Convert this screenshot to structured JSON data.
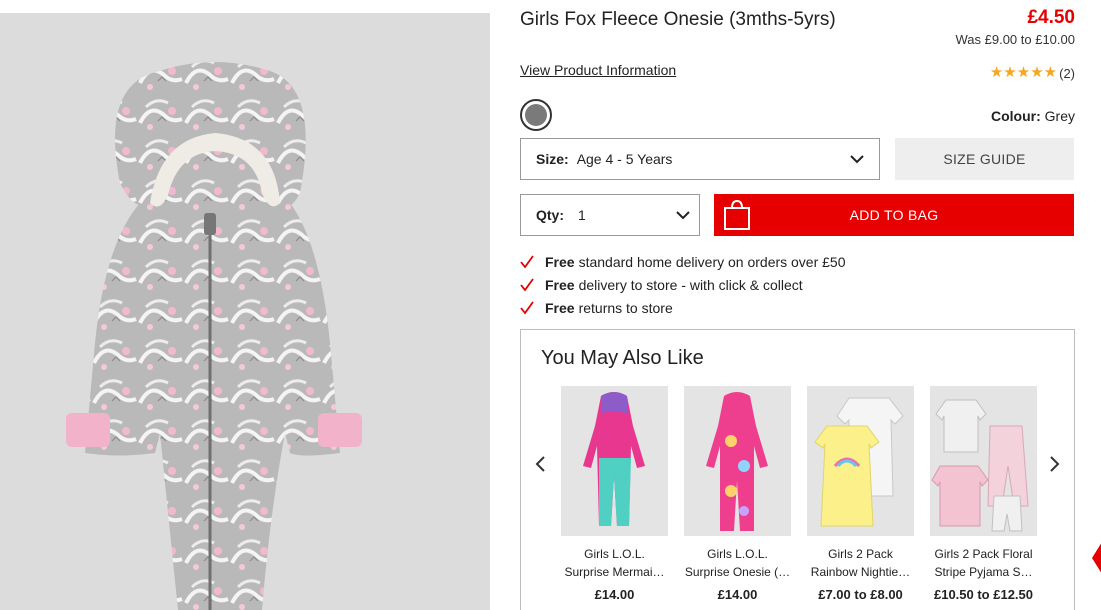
{
  "product": {
    "title": "Girls Fox Fleece Onesie (3mths-5yrs)",
    "price": "£4.50",
    "was_price": "Was £9.00 to £10.00",
    "view_info_label": "View Product Information",
    "rating": {
      "stars": 5,
      "count": "(2)"
    },
    "colour": {
      "label": "Colour:",
      "value": "Grey",
      "swatch": "#7a7a7a"
    }
  },
  "size_select": {
    "label": "Size:",
    "value": "Age 4 - 5 Years"
  },
  "size_guide_label": "SIZE GUIDE",
  "qty_select": {
    "label": "Qty:",
    "value": "1"
  },
  "add_to_bag_label": "ADD TO BAG",
  "benefits": [
    {
      "bold": "Free",
      "text": "standard home delivery on orders over £50"
    },
    {
      "bold": "Free",
      "text": "delivery to store - with click & collect"
    },
    {
      "bold": "Free",
      "text": "returns to store"
    }
  ],
  "recommendations": {
    "title": "You May Also Like",
    "items": [
      {
        "name": "Girls L.O.L. Surprise Mermai…",
        "price": "£14.00"
      },
      {
        "name": "Girls L.O.L. Surprise Onesie (…",
        "price": "£14.00"
      },
      {
        "name": "Girls 2 Pack Rainbow Nightie…",
        "price": "£7.00 to £8.00"
      },
      {
        "name": "Girls 2 Pack Floral Stripe Pyjama S…",
        "price": "£10.50 to £12.50"
      }
    ]
  },
  "colors": {
    "accent": "#e60000",
    "star": "#f5a623",
    "tick": "#e60000"
  },
  "icons": [
    "chevron-down-icon",
    "shopping-bag-icon",
    "tick-icon",
    "chevron-left-icon",
    "chevron-right-icon",
    "star-icon"
  ]
}
